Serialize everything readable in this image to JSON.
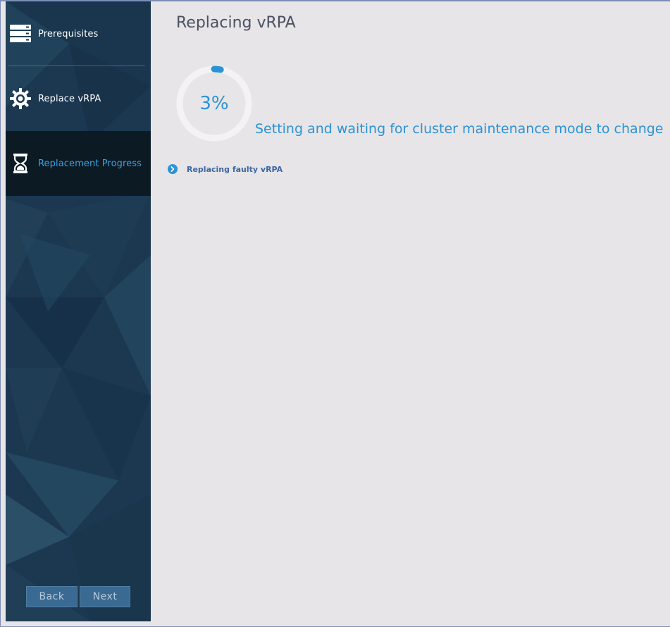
{
  "sidebar": {
    "items": [
      {
        "label": "Prerequisites",
        "icon": "server-stack-icon",
        "active": false
      },
      {
        "label": "Replace vRPA",
        "icon": "gear-icon",
        "active": false
      },
      {
        "label": "Replacement Progress",
        "icon": "hourglass-icon",
        "active": true
      }
    ],
    "buttons": {
      "back_label": "Back",
      "next_label": "Next"
    }
  },
  "main": {
    "title": "Replacing vRPA",
    "progress": {
      "percent": 3,
      "percent_label": "3%",
      "status": "Setting and waiting for cluster maintenance mode to change"
    },
    "steps": [
      {
        "label": "Replacing faulty vRPA",
        "icon": "chevron-right-circle-icon"
      }
    ]
  },
  "colors": {
    "accent": "#2a93d6",
    "sidebar_bg": "#1c3a52",
    "active_item_bg": "#0c1a24",
    "main_bg": "#e8e5e8",
    "step_text": "#3b66a3",
    "button_bg": "#3a6a91"
  }
}
